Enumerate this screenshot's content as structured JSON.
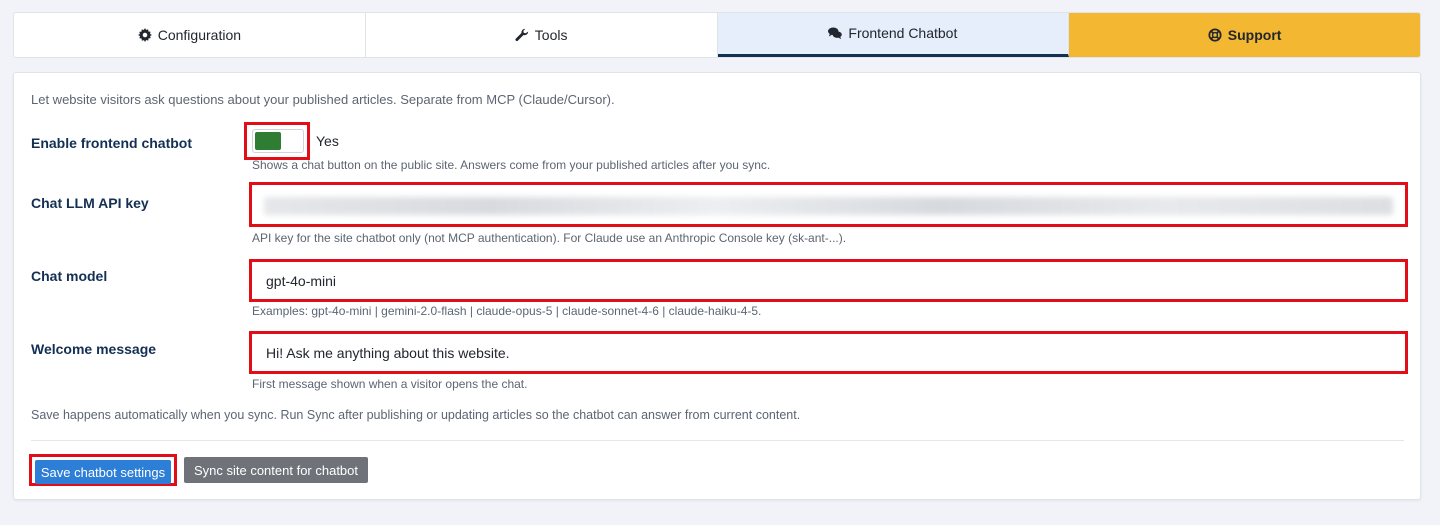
{
  "tabs": [
    {
      "label": "Configuration",
      "icon": "gear-icon"
    },
    {
      "label": "Tools",
      "icon": "wrench-icon"
    },
    {
      "label": "Frontend Chatbot",
      "icon": "chat-bubbles-icon"
    },
    {
      "label": "Support",
      "icon": "lifebuoy-icon"
    }
  ],
  "active_tab": "Frontend Chatbot",
  "intro": "Let website visitors ask questions about your published articles. Separate from MCP (Claude/Cursor).",
  "fields": {
    "enable": {
      "label": "Enable frontend chatbot",
      "value_label": "Yes",
      "enabled": true,
      "help": "Shows a chat button on the public site. Answers come from your published articles after you sync."
    },
    "api_key": {
      "label": "Chat LLM API key",
      "value": "",
      "help": "API key for the site chatbot only (not MCP authentication). For Claude use an Anthropic Console key (sk-ant-...)."
    },
    "model": {
      "label": "Chat model",
      "value": "gpt-4o-mini",
      "help": "Examples: gpt-4o-mini | gemini-2.0-flash | claude-opus-5 | claude-sonnet-4-6 | claude-haiku-4-5."
    },
    "welcome": {
      "label": "Welcome message",
      "value": "Hi! Ask me anything about this website.",
      "help": "First message shown when a visitor opens the chat."
    }
  },
  "save_note": "Save happens automatically when you sync. Run Sync after publishing or updating articles so the chatbot can answer from current content.",
  "buttons": {
    "save": "Save chatbot settings",
    "sync": "Sync site content for chatbot"
  },
  "colors": {
    "accent_navy": "#132f53",
    "support_yellow": "#f4b731",
    "toggle_green": "#2e7d32",
    "highlight_red": "#e10d17",
    "primary_blue": "#2c7ed6",
    "secondary_gray": "#6f7379"
  }
}
